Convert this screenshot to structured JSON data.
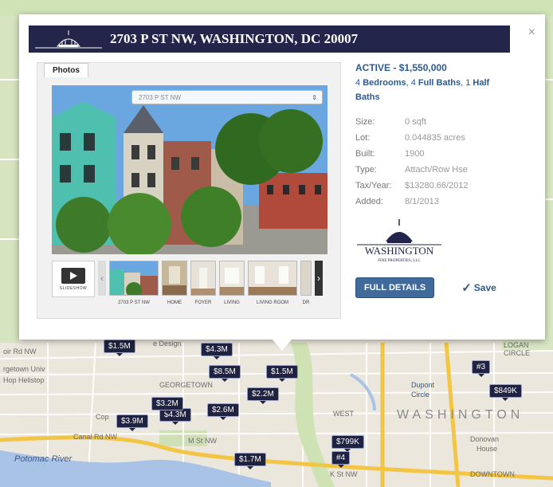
{
  "popup": {
    "title": "2703 P ST NW, WASHINGTON, DC 20007",
    "close_glyph": "×",
    "photos_tab_label": "Photos",
    "photo_select_value": "2703 P ST NW",
    "photo_select_arrow": "⇕",
    "slideshow_label": "SLIDESHOW",
    "thumb_arrow_left": "‹",
    "thumb_arrow_right": "›",
    "thumbnails": [
      "2703 P ST NW",
      "HOME",
      "FOYER",
      "LIVING",
      "LIVING ROOM",
      "DR"
    ],
    "status_active": "ACTIVE",
    "status_separator": " - ",
    "price": "$1,550,000",
    "beds_count": "4",
    "beds_label": "Bedrooms",
    "full_baths_count": "4",
    "full_baths_label": "Full Baths",
    "half_baths_count": "1",
    "half_baths_label": "Half",
    "half_baths_label2": "Baths",
    "facts": [
      {
        "label": "Size:",
        "value": "0 sqft"
      },
      {
        "label": "Lot:",
        "value": "0.044835 acres"
      },
      {
        "label": "Built:",
        "value": "1900"
      },
      {
        "label": "Type:",
        "value": "Attach/Row Hse"
      },
      {
        "label": "Tax/Year:",
        "value": "$13280.66/2012"
      },
      {
        "label": "Added:",
        "value": "8/1/2013"
      }
    ],
    "logo_text_main": "WASHINGTON",
    "logo_text_sub": "FINE PROPERTIES, LLC",
    "full_details_label": "FULL DETAILS",
    "save_label": "Save",
    "save_check": "✓"
  },
  "map": {
    "labels": {
      "washington": "WASHINGTON",
      "potomac": "Potomac River",
      "dupont": "Dupont",
      "dupont2": "Circle",
      "georgetown": "GEORGETOWN",
      "m_st": "M St NW",
      "canal": "Canal Rd NW",
      "donovan": "Donovan",
      "donovan2": "House",
      "west": "WEST",
      "logan": "LOGAN",
      "circle": "CIRCLE",
      "design": "e Design",
      "reservoir": "oir Rd NW",
      "univ": "rgetown Univ",
      "hop": "Hop Helistop",
      "k_st": "K St NW",
      "downtown": "DOWNTOWN",
      "cop": "Cop"
    },
    "markers": [
      "$1.5M",
      "$4.3M",
      "$8.5M",
      "$1.5M",
      "$2.2M",
      "$2.6M",
      "$4.3M",
      "$3.9M",
      "$3.2M",
      "$799K",
      "#4",
      "$1.7M",
      "#3",
      "$849K"
    ]
  },
  "colors": {
    "title_bar": "#23264a",
    "link_blue": "#2c5a8f",
    "button_blue": "#3f6a9a",
    "marker": "#1f2240",
    "road_yellow": "#f3c545",
    "water": "#a9c3e6"
  }
}
